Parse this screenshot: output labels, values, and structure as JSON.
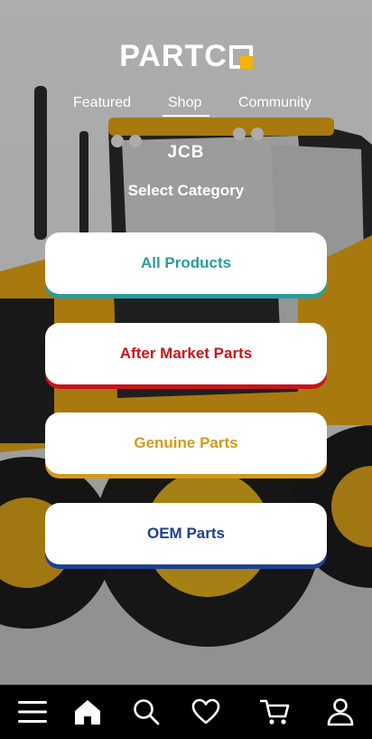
{
  "header": {
    "logo_text": "PARTC"
  },
  "tabs": [
    {
      "label": "Featured",
      "active": false
    },
    {
      "label": "Shop",
      "active": true
    },
    {
      "label": "Community",
      "active": false
    }
  ],
  "brand": "JCB",
  "select_category_label": "Select Category",
  "categories": [
    {
      "label": "All Products",
      "color": "#2a9d9b"
    },
    {
      "label": "After Market Parts",
      "color": "#c8151b"
    },
    {
      "label": "Genuine Parts",
      "color": "#d39a1c"
    },
    {
      "label": "OEM Parts",
      "color": "#1f3f8f"
    }
  ],
  "bottom_nav": [
    {
      "icon": "menu-icon"
    },
    {
      "icon": "home-icon"
    },
    {
      "icon": "search-icon"
    },
    {
      "icon": "heart-icon"
    },
    {
      "icon": "cart-icon"
    },
    {
      "icon": "profile-icon"
    }
  ],
  "colors": {
    "logo_accent": "#f4b400",
    "nav_background": "#000000",
    "tractor_yellow": "#f2b01e"
  }
}
